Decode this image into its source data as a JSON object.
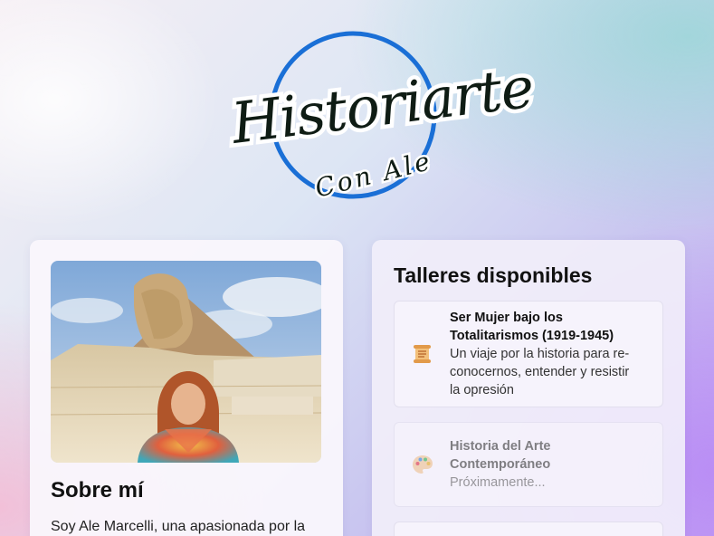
{
  "brand": {
    "logo_main": "Historiarte",
    "logo_sub": "Con Ale",
    "colors": {
      "ring": "#1a6fd6",
      "ink": "#0f1c14"
    }
  },
  "about": {
    "photo_alt": "Ale Marcelli frente a la Esfinge de Giza",
    "title": "Sobre mí",
    "text": "Soy Ale Marcelli, una apasionada por la"
  },
  "workshops": {
    "title": "Talleres disponibles",
    "items": [
      {
        "icon": "scroll-icon",
        "name_line1": "Ser Mujer bajo los",
        "name_line2": "Totalitarismos (1919-1945)",
        "desc_line1": "Un viaje por la historia para re-",
        "desc_line2": "conocernos, entender y resistir",
        "desc_line3": "la opresión"
      },
      {
        "icon": "palette-icon",
        "name_line1": "Historia del Arte",
        "name_line2": "Contemporáneo",
        "desc_line1": "Próximamente..."
      }
    ]
  }
}
